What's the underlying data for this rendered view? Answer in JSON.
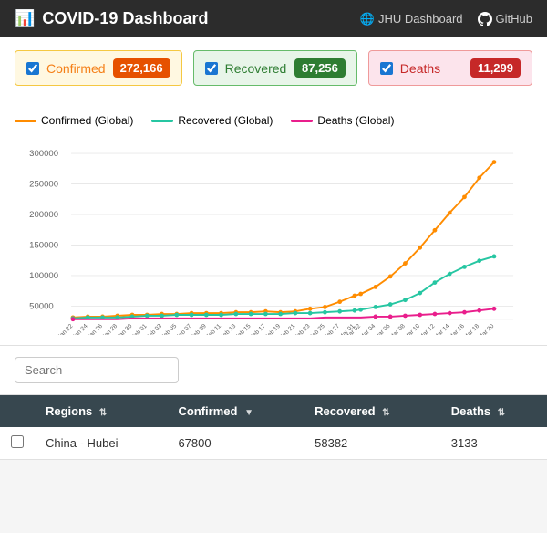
{
  "header": {
    "title": "COVID-19 Dashboard",
    "icon": "📊",
    "links": [
      {
        "label": "JHU Dashboard",
        "icon": "🌐"
      },
      {
        "label": "GitHub",
        "icon": ""
      }
    ]
  },
  "cards": [
    {
      "key": "confirmed",
      "label": "Confirmed",
      "value": "272,166",
      "checked": true
    },
    {
      "key": "recovered",
      "label": "Recovered",
      "value": "87,256",
      "checked": true
    },
    {
      "key": "deaths",
      "label": "Deaths",
      "value": "11,299",
      "checked": true
    }
  ],
  "chart": {
    "legend": [
      {
        "label": "Confirmed (Global)",
        "color": "#ff8c00"
      },
      {
        "label": "Recovered (Global)",
        "color": "#26c6a2"
      },
      {
        "label": "Deaths (Global)",
        "color": "#e91e8c"
      }
    ],
    "yLabels": [
      "300000",
      "250000",
      "200000",
      "150000",
      "100000",
      "50000"
    ],
    "xLabels": [
      "Jan 22, 2020",
      "Jan 24, 2020",
      "Jan 26, 2020",
      "Jan 28, 2020",
      "Jan 30, 2020",
      "Feb 01, 2020",
      "Feb 03, 2020",
      "Feb 05, 2020",
      "Feb 07, 2020",
      "Feb 09, 2020",
      "Feb 11, 2020",
      "Feb 13, 2020",
      "Feb 15, 2020",
      "Feb 17, 2020",
      "Feb 19, 2020",
      "Feb 21, 2020",
      "Feb 23, 2020",
      "Feb 25, 2020",
      "Feb 27, 2020",
      "Mar 01, 2020",
      "Mar 02, 2020",
      "Mar 04, 2020",
      "Mar 06, 2020",
      "Mar 08, 2020",
      "Mar 10, 2020",
      "Mar 12, 2020",
      "Mar 14, 2020",
      "Mar 16, 2020",
      "Mar 18, 2020",
      "Mar 20, 2020"
    ]
  },
  "search": {
    "placeholder": "Search",
    "value": ""
  },
  "table": {
    "columns": [
      {
        "label": "",
        "key": "checkbox"
      },
      {
        "label": "Regions",
        "key": "region",
        "sortable": true
      },
      {
        "label": "Confirmed",
        "key": "confirmed",
        "sortable": true
      },
      {
        "label": "Recovered",
        "key": "recovered",
        "sortable": true
      },
      {
        "label": "Deaths",
        "key": "deaths",
        "sortable": true
      }
    ],
    "rows": [
      {
        "region": "China - Hubei",
        "confirmed": "67800",
        "recovered": "58382",
        "deaths": "3133"
      }
    ]
  }
}
